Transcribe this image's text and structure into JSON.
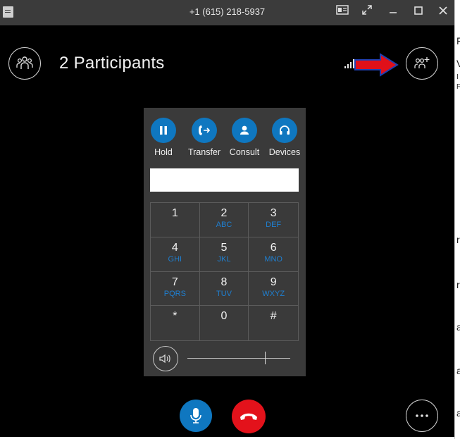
{
  "window": {
    "title": "+1 (615) 218-5937",
    "controls": [
      "contact-card-icon",
      "pop-out-icon",
      "minimize-icon",
      "maximize-icon",
      "close-icon"
    ]
  },
  "header": {
    "participants_label": "2 Participants",
    "participants_icon": "people-icon",
    "add_people_icon": "add-people-icon",
    "annotation_arrow_color": "#e0101a"
  },
  "dialpad": {
    "actions": [
      {
        "label": "Hold",
        "icon": "pause-icon"
      },
      {
        "label": "Transfer",
        "icon": "transfer-icon"
      },
      {
        "label": "Consult",
        "icon": "consult-icon"
      },
      {
        "label": "Devices",
        "icon": "headset-icon"
      }
    ],
    "input_value": "",
    "keys": [
      {
        "digit": "1",
        "letters": ""
      },
      {
        "digit": "2",
        "letters": "ABC"
      },
      {
        "digit": "3",
        "letters": "DEF"
      },
      {
        "digit": "4",
        "letters": "GHI"
      },
      {
        "digit": "5",
        "letters": "JKL"
      },
      {
        "digit": "6",
        "letters": "MNO"
      },
      {
        "digit": "7",
        "letters": "PQRS"
      },
      {
        "digit": "8",
        "letters": "TUV"
      },
      {
        "digit": "9",
        "letters": "WXYZ"
      },
      {
        "digit": "*",
        "letters": ""
      },
      {
        "digit": "0",
        "letters": ""
      },
      {
        "digit": "#",
        "letters": ""
      }
    ],
    "volume_level": 0.75
  },
  "call_controls": {
    "mic_icon": "microphone-icon",
    "hangup_icon": "hang-up-icon",
    "more_icon": "more-options-icon"
  },
  "colors": {
    "accent": "#0f77c0",
    "hangup": "#e3121b",
    "letters": "#1f7fd0"
  },
  "background_strip": {
    "letters": [
      "F",
      "V",
      "I",
      "F",
      "r",
      "r",
      "a",
      "a",
      "a"
    ]
  }
}
